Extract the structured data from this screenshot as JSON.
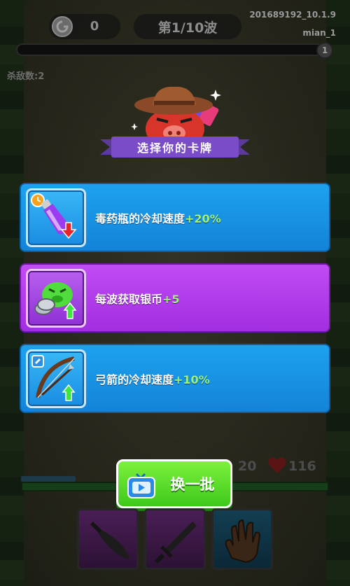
{
  "hud": {
    "coin_count": "0",
    "wave_label": "第1/10波",
    "build_version": "201689192_10.1.9",
    "user_name": "mian_1",
    "progress_badge": "1",
    "kill_count_label": "杀敌数:2"
  },
  "dialog": {
    "title": "选择你的卡牌",
    "cards": [
      {
        "name": "毒药瓶的冷却速度",
        "bonus": "+20%",
        "color": "#1a97e8",
        "icon": "poison-potion-icon"
      },
      {
        "name": "每波获取银币",
        "bonus": "+5",
        "color": "#b23fec",
        "icon": "silver-coin-pig-icon"
      },
      {
        "name": "弓箭的冷却速度",
        "bonus": "+10%",
        "color": "#1a97e8",
        "icon": "bow-arrow-icon"
      }
    ],
    "refresh_button": "换一批"
  },
  "stats": {
    "shield": "20",
    "health": "116"
  },
  "slots": [
    {
      "icon": "knife-icon"
    },
    {
      "icon": "sword-icon"
    },
    {
      "icon": "glove-icon"
    }
  ],
  "colors": {
    "blue_card": "#1a97e8",
    "purple_card": "#b23fec",
    "bonus_green": "#9cf27a",
    "button_green": "#5ade2c"
  }
}
